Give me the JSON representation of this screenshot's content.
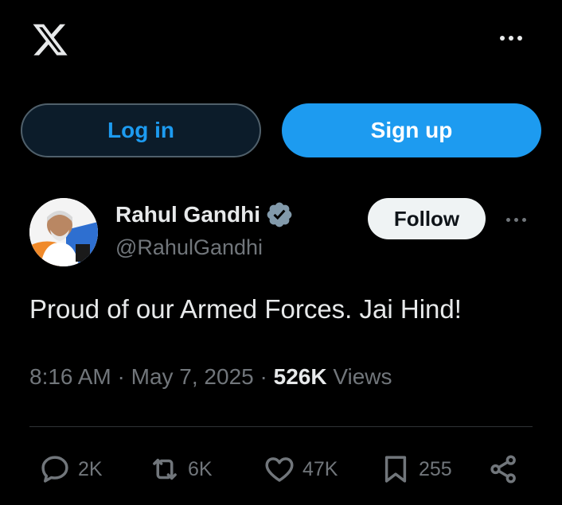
{
  "header": {
    "logo": "x-logo-icon",
    "more": "more-icon"
  },
  "auth": {
    "login_label": "Log in",
    "signup_label": "Sign up"
  },
  "author": {
    "name": "Rahul Gandhi",
    "handle": "@RahulGandhi",
    "follow_label": "Follow",
    "verified": true
  },
  "tweet": {
    "text": "Proud of our Armed Forces. Jai Hind!",
    "time": "8:16 AM",
    "sep1": " · ",
    "date": "May 7, 2025",
    "sep2": " · ",
    "views_count": "526K",
    "views_label": " Views"
  },
  "actions": {
    "replies": "2K",
    "reposts": "6K",
    "likes": "47K",
    "bookmarks": "255"
  },
  "colors": {
    "accent": "#1d9bf0",
    "background": "#000000",
    "muted": "#71767b"
  }
}
